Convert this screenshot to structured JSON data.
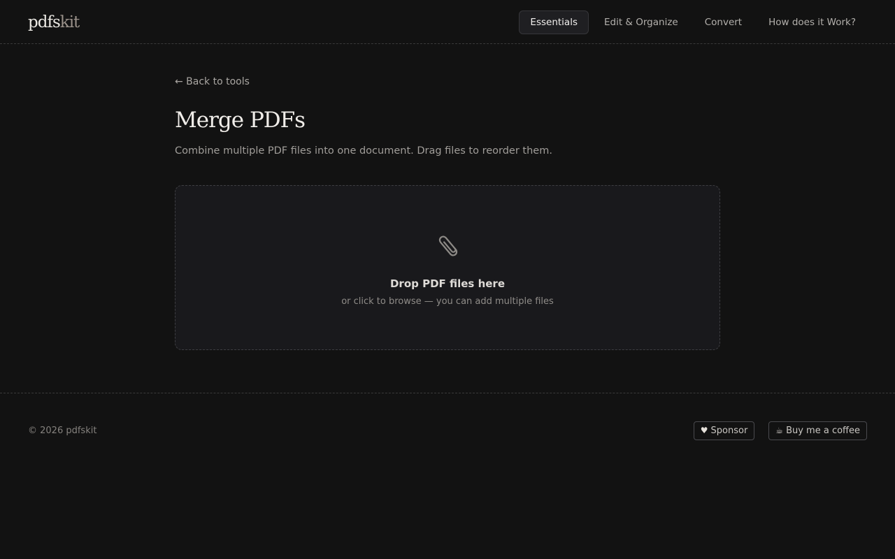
{
  "header": {
    "logo_part1": "pdfs",
    "logo_part2": "kit",
    "nav": [
      {
        "label": "Essentials",
        "active": true
      },
      {
        "label": "Edit & Organize",
        "active": false
      },
      {
        "label": "Convert",
        "active": false
      },
      {
        "label": "How does it Work?",
        "active": false
      }
    ]
  },
  "main": {
    "back_label": "← Back to tools",
    "title": "Merge PDFs",
    "subtitle": "Combine multiple PDF files into one document. Drag files to reorder them.",
    "dropzone": {
      "icon": "paperclip-icon",
      "title": "Drop PDF files here",
      "hint": "or click to browse — you can add multiple files"
    }
  },
  "footer": {
    "copyright": "© 2026 pdfskit",
    "sponsor_icon": "♥",
    "sponsor_label": "Sponsor",
    "coffee_icon": "☕",
    "coffee_label": "Buy me a coffee"
  },
  "colors": {
    "background": "#121212",
    "dropzone_bg": "#19191c",
    "text_primary": "#f0ede9",
    "text_muted": "#a09d99"
  }
}
